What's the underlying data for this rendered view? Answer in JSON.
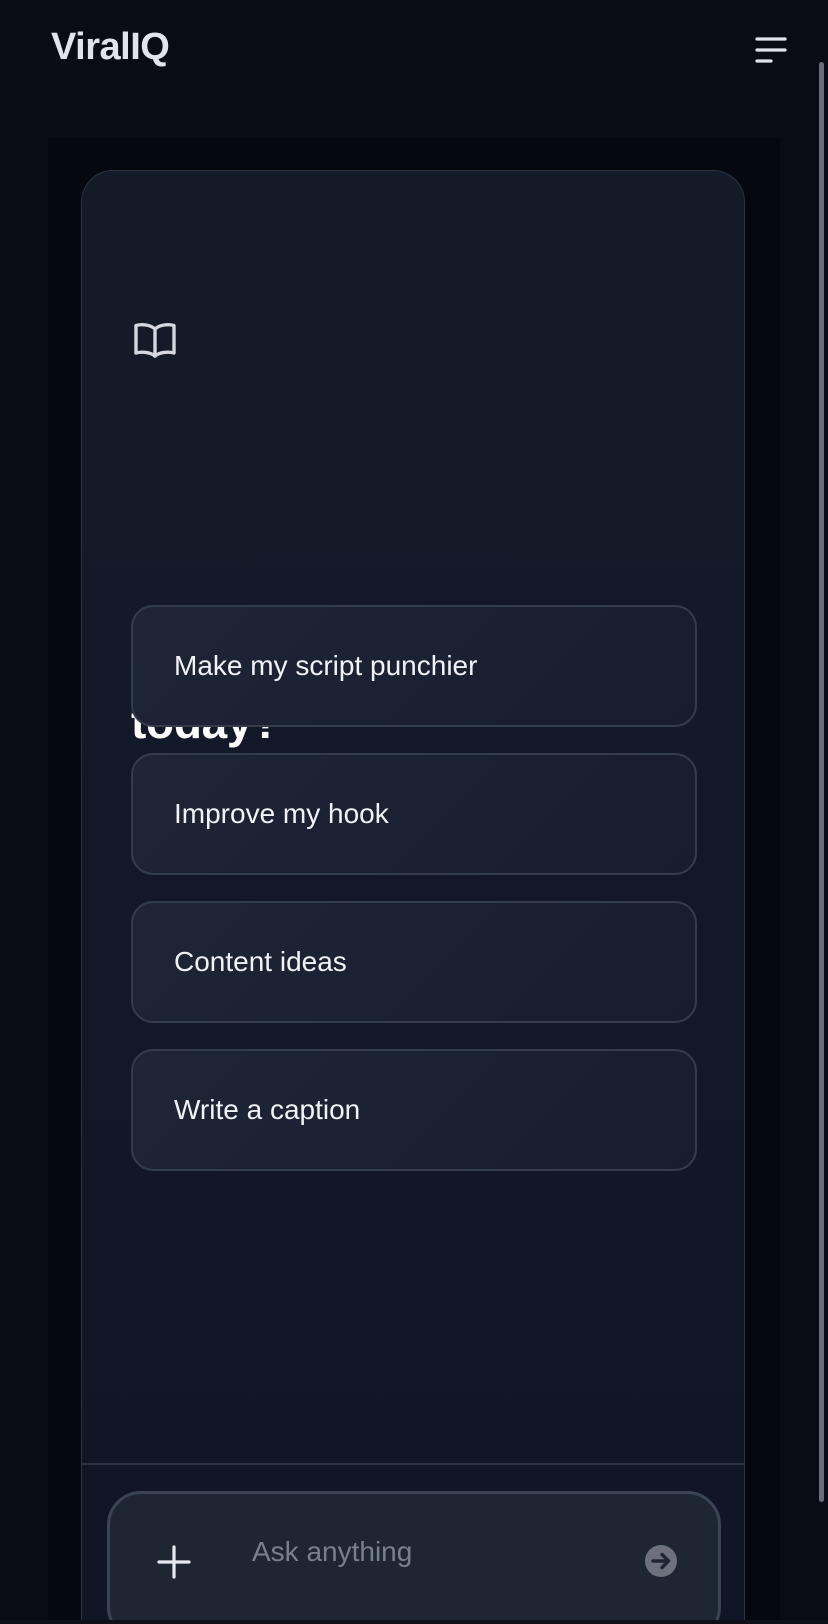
{
  "header": {
    "app_name": "ViralIQ",
    "menu_icon": "hamburger-menu-icon"
  },
  "main": {
    "top_icon": "open-book-icon",
    "heading": "What are we cooking up today?",
    "suggestions": [
      {
        "label": "Make my script punchier"
      },
      {
        "label": "Improve my hook"
      },
      {
        "label": "Content ideas"
      },
      {
        "label": "Write a caption"
      }
    ]
  },
  "composer": {
    "add_icon": "plus-icon",
    "placeholder": "Ask anything",
    "value": "",
    "send_icon": "arrow-right-circle-icon"
  },
  "colors": {
    "background": "#0a0b14",
    "card": "#131a28",
    "suggestion_bg": "#1c2333",
    "border": "#333c4c",
    "text": "#f2f3f7",
    "placeholder": "#79808d",
    "send_button": "#6c717d"
  }
}
